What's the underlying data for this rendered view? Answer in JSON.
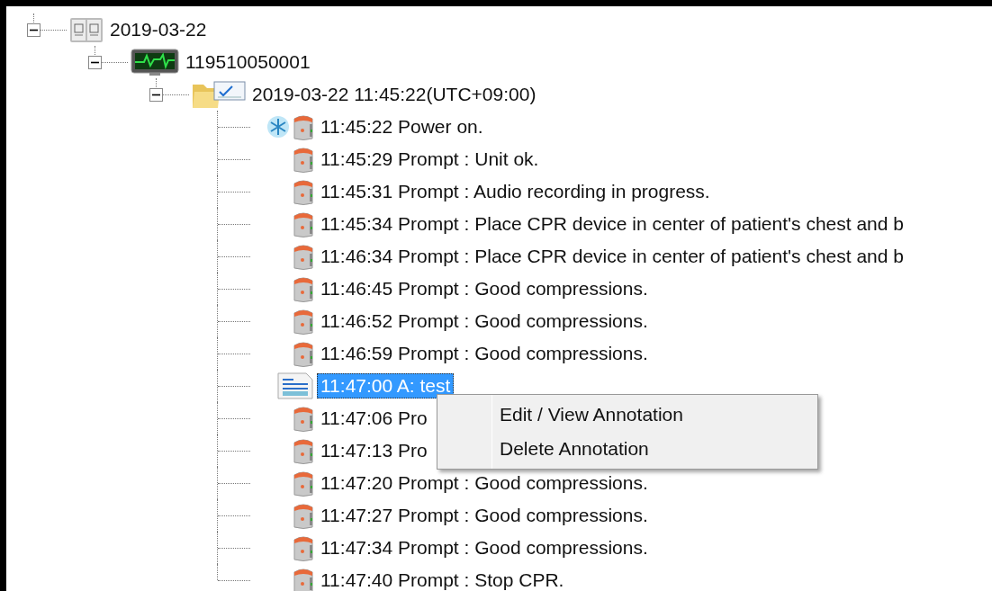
{
  "tree": [
    {
      "kind": "date",
      "label": "2019-03-22",
      "expanded": true,
      "children": [
        {
          "kind": "device",
          "label": "119510050001",
          "expanded": true,
          "children": [
            {
              "kind": "session",
              "label": "2019-03-22 11:45:22(UTC+09:00)",
              "expanded": true,
              "children": [
                {
                  "kind": "power",
                  "label": "11:45:22 Power on.",
                  "selected": false
                },
                {
                  "kind": "prompt",
                  "label": "11:45:29 Prompt : Unit ok.",
                  "selected": false
                },
                {
                  "kind": "prompt",
                  "label": "11:45:31 Prompt : Audio recording in progress.",
                  "selected": false
                },
                {
                  "kind": "prompt",
                  "label": "11:45:34 Prompt : Place CPR device in center of patient's chest and b",
                  "selected": false
                },
                {
                  "kind": "prompt",
                  "label": "11:46:34 Prompt : Place CPR device in center of patient's chest and b",
                  "selected": false
                },
                {
                  "kind": "prompt",
                  "label": "11:46:45 Prompt : Good compressions.",
                  "selected": false
                },
                {
                  "kind": "prompt",
                  "label": "11:46:52 Prompt : Good compressions.",
                  "selected": false
                },
                {
                  "kind": "prompt",
                  "label": "11:46:59 Prompt : Good compressions.",
                  "selected": false
                },
                {
                  "kind": "annotation",
                  "label": "11:47:00 A: test",
                  "selected": true
                },
                {
                  "kind": "prompt",
                  "label": "11:47:06 Pro",
                  "selected": false
                },
                {
                  "kind": "prompt",
                  "label": "11:47:13 Pro",
                  "selected": false
                },
                {
                  "kind": "prompt",
                  "label": "11:47:20 Prompt : Good compressions.",
                  "selected": false
                },
                {
                  "kind": "prompt",
                  "label": "11:47:27 Prompt : Good compressions.",
                  "selected": false
                },
                {
                  "kind": "prompt",
                  "label": "11:47:34 Prompt : Good compressions.",
                  "selected": false
                },
                {
                  "kind": "prompt",
                  "label": "11:47:40 Prompt : Stop CPR.",
                  "selected": false
                }
              ]
            }
          ]
        }
      ]
    }
  ],
  "context_menu": {
    "items": [
      "Edit / View Annotation",
      "Delete Annotation"
    ]
  }
}
